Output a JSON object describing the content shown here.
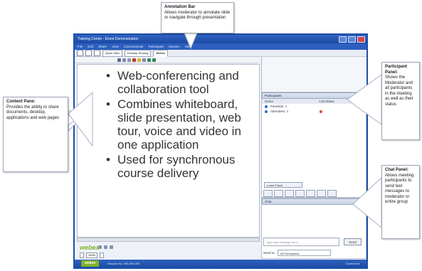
{
  "window": {
    "title": "Training Center - Event Demonstration",
    "menu": [
      "File",
      "Edit",
      "Share",
      "View",
      "Communicate",
      "Participant",
      "Session",
      "Help"
    ]
  },
  "toolbar": {
    "tabs": [
      "Quick Start",
      "Desktop Sharing",
      "Webex"
    ]
  },
  "content": {
    "bullets": [
      "Web-conferencing and collaboration tool",
      "Combines whiteboard, slide presentation, web tour, voice and video in one application",
      "Used for synchronous course delivery"
    ],
    "logo": "webex",
    "zoom": "100%"
  },
  "participants": {
    "header": "Participants",
    "columns": [
      "Name",
      "Call Status"
    ],
    "rows": [
      "Panelists: 1",
      "Attendees: 1"
    ],
    "button": "Lower Panel"
  },
  "chat": {
    "header": "Chat",
    "input_placeholder": "Type chat message here...",
    "send_label": "Send",
    "send_to_label": "Send to:",
    "send_to_value": "All Participants"
  },
  "status_bar": {
    "logo": "webex",
    "text": "Session No. 000-000-000",
    "right": "Connected"
  },
  "callouts": {
    "annotation": {
      "title": "Annotation Bar",
      "text": "Allows moderator to annotate slide or navigate through presentation"
    },
    "content": {
      "title": "Content Pane:",
      "text": "Provides the ability to share documents, desktop, applications and web pages"
    },
    "participant": {
      "title": "Participant Panel:",
      "text": "Shows the Moderator and all participants in the meeting as well as their status"
    },
    "chat": {
      "title": "Chat Panel:",
      "text": "Allows meeting participants to send text messages to moderator or entire group"
    }
  },
  "colors": {
    "window_blue": "#1e4fa8",
    "webex_green": "#7fb32b"
  }
}
